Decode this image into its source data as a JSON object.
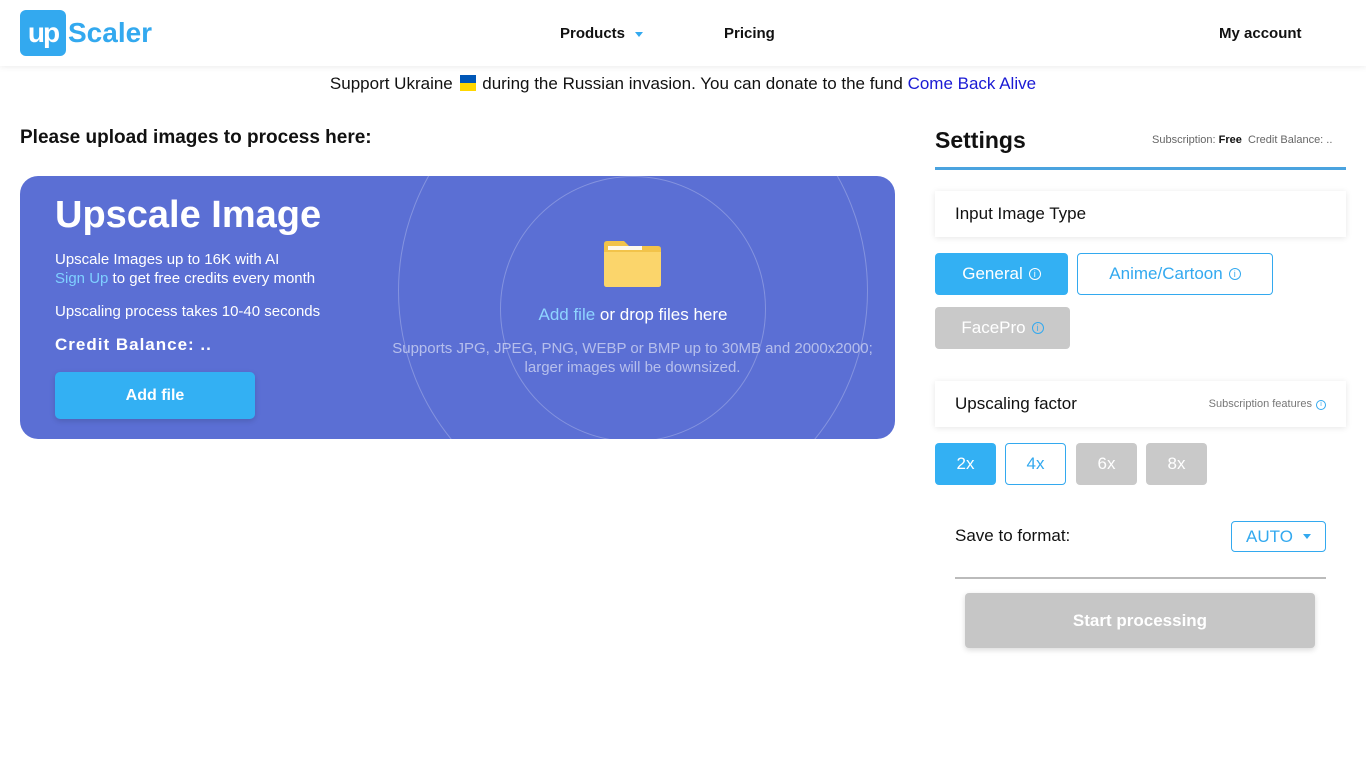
{
  "header": {
    "logo_mark": "up",
    "logo_text": "Scaler",
    "nav": {
      "products": "Products",
      "pricing": "Pricing",
      "account": "My account"
    },
    "accent_color": "#33a9ef"
  },
  "banner": {
    "text_before": "Support Ukraine",
    "text_after": "during the Russian invasion. You can donate to the fund",
    "link": "Come Back Alive"
  },
  "upload": {
    "section_title": "Please upload images to process here:",
    "card_title": "Upscale Image",
    "line1": "Upscale Images up to 16K with AI",
    "signup_link": "Sign Up",
    "signup_rest": "to get free credits every month",
    "line3": "Upscaling process takes 10-40 seconds",
    "credit_balance": "Credit Balance: ..",
    "add_file_button": "Add file",
    "drop_link": "Add file",
    "drop_rest": "or drop files here",
    "supports_line1": "Supports JPG, JPEG, PNG, WEBP or BMP up to 30MB and 2000x2000;",
    "supports_line2": "larger images will be downsized."
  },
  "settings": {
    "title": "Settings",
    "subscription_label": "Subscription:",
    "subscription_value": "Free",
    "credit_label": "Credit Balance: ..",
    "input_type_label": "Input Image Type",
    "types": {
      "general": "General",
      "anime": "Anime/Cartoon",
      "facepro": "FacePro"
    },
    "upscaling_label": "Upscaling factor",
    "subscription_features": "Subscription features",
    "factors": [
      "2x",
      "4x",
      "6x",
      "8x"
    ],
    "save_format_label": "Save to format:",
    "format_value": "AUTO",
    "start_button": "Start processing",
    "info_glyph": "i"
  }
}
